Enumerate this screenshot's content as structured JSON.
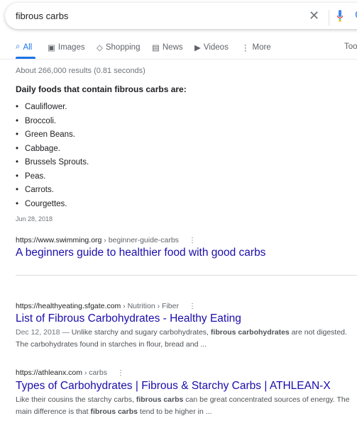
{
  "search": {
    "query": "fibrous carbs"
  },
  "tabs": [
    {
      "label": "All",
      "icon": "search-icon"
    },
    {
      "label": "Images",
      "icon": "image-icon"
    },
    {
      "label": "Shopping",
      "icon": "tag-icon"
    },
    {
      "label": "News",
      "icon": "newspaper-icon"
    },
    {
      "label": "Videos",
      "icon": "play-icon"
    },
    {
      "label": "More",
      "icon": "more-vert-icon"
    }
  ],
  "tools_label": "Too",
  "stats": "About 266,000 results (0.81 seconds)",
  "snippet": {
    "heading": "Daily foods that contain fibrous carbs are:",
    "items": [
      "Cauliflower.",
      "Broccoli.",
      "Green Beans.",
      "Cabbage.",
      "Brussels Sprouts.",
      "Peas.",
      "Carrots.",
      "Courgettes."
    ],
    "date": "Jun 28, 2018"
  },
  "results": [
    {
      "url": "https://www.swimming.org",
      "crumbs": " › beginner-guide-carbs",
      "title": "A beginners guide to healthier food with good carbs"
    },
    {
      "url": "https://healthyeating.sfgate.com",
      "crumbs": " › Nutrition › Fiber",
      "title": "List of Fibrous Carbohydrates - Healthy Eating",
      "date": "Dec 12, 2018 — ",
      "parts": [
        "Unlike starchy and sugary carbohydrates, ",
        "fibrous carbohydrates",
        " are not digested. The carbohydrates found in starches in flour, bread and ..."
      ]
    },
    {
      "url": "https://athleanx.com",
      "crumbs": " › carbs",
      "title": "Types of Carbohydrates | Fibrous & Starchy Carbs | ATHLEAN-X",
      "parts": [
        "Like their cousins the starchy carbs, ",
        "fibrous carbs",
        " can be great concentrated sources of energy. The main difference is that ",
        "fibrous carbs",
        " tend to be higher in ..."
      ]
    }
  ],
  "colors": {
    "link": "#1a0dab",
    "accent": "#1a73e8"
  }
}
